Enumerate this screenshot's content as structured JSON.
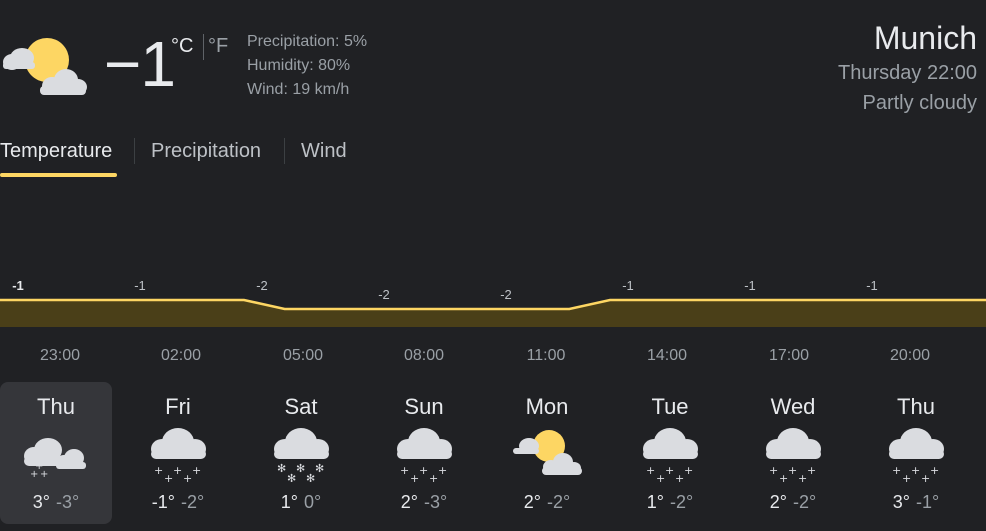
{
  "current": {
    "temp": "−1",
    "unit_c": "°C",
    "unit_f": "°F",
    "precipitation": "Precipitation: 5%",
    "humidity": "Humidity: 80%",
    "wind": "Wind: 19 km/h",
    "icon": "partly-cloudy-icon"
  },
  "location": {
    "city": "Munich",
    "day_time": "Thursday 22:00",
    "condition": "Partly cloudy"
  },
  "tabs": [
    {
      "label": "Temperature",
      "active": true
    },
    {
      "label": "Precipitation",
      "active": false
    },
    {
      "label": "Wind",
      "active": false
    }
  ],
  "colors": {
    "accent": "#fdd663",
    "fill": "#4a3f18",
    "background": "#202124",
    "selected_day_bg": "#35363a"
  },
  "chart_data": {
    "type": "area",
    "x": [
      "22:00",
      "23:00",
      "00:00",
      "01:00",
      "02:00",
      "03:00",
      "04:00",
      "05:00",
      "06:00",
      "07:00",
      "08:00",
      "09:00",
      "10:00",
      "11:00",
      "12:00",
      "13:00",
      "14:00",
      "15:00",
      "16:00",
      "17:00",
      "18:00",
      "19:00",
      "20:00",
      "21:00",
      "22:00"
    ],
    "values": [
      -1,
      -1,
      -1,
      -1,
      -1,
      -1,
      -1,
      -2,
      -2,
      -2,
      -2,
      -2,
      -2,
      -2,
      -2,
      -1,
      -1,
      -1,
      -1,
      -1,
      -1,
      -1,
      -1,
      -1,
      -1
    ],
    "labels": [
      {
        "text": "-1",
        "index": 0
      },
      {
        "text": "-1",
        "index": 3
      },
      {
        "text": "-2",
        "index": 6
      },
      {
        "text": "-2",
        "index": 9
      },
      {
        "text": "-2",
        "index": 12
      },
      {
        "text": "-1",
        "index": 15
      },
      {
        "text": "-1",
        "index": 18
      },
      {
        "text": "-1",
        "index": 21
      }
    ],
    "hour_ticks": [
      "23:00",
      "02:00",
      "05:00",
      "08:00",
      "11:00",
      "14:00",
      "17:00",
      "20:00"
    ]
  },
  "days": [
    {
      "name": "Thu",
      "hi": "3°",
      "lo": "-3°",
      "icon": "snow-partly-cloudy-icon",
      "selected": true
    },
    {
      "name": "Fri",
      "hi": "-1°",
      "lo": "-2°",
      "icon": "snow-icon",
      "selected": false
    },
    {
      "name": "Sat",
      "hi": "1°",
      "lo": "0°",
      "icon": "heavy-snow-icon",
      "selected": false
    },
    {
      "name": "Sun",
      "hi": "2°",
      "lo": "-3°",
      "icon": "snow-icon",
      "selected": false
    },
    {
      "name": "Mon",
      "hi": "2°",
      "lo": "-2°",
      "icon": "partly-cloudy-icon",
      "selected": false
    },
    {
      "name": "Tue",
      "hi": "1°",
      "lo": "-2°",
      "icon": "snow-icon",
      "selected": false
    },
    {
      "name": "Wed",
      "hi": "2°",
      "lo": "-2°",
      "icon": "snow-icon",
      "selected": false
    },
    {
      "name": "Thu",
      "hi": "3°",
      "lo": "-1°",
      "icon": "snow-icon",
      "selected": false
    }
  ]
}
